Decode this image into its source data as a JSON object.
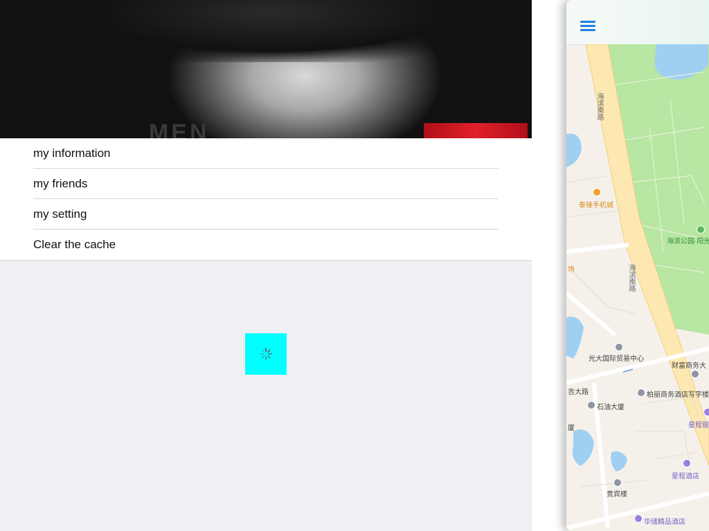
{
  "menu": {
    "items": [
      {
        "label": "my information"
      },
      {
        "label": "my friends"
      },
      {
        "label": "my setting"
      },
      {
        "label": "Clear the cache"
      }
    ]
  },
  "header": {
    "brand_text": "MEN",
    "image_desc_icon": "profile-photo"
  },
  "loading": {
    "icon": "activity-spinner-icon",
    "box_color": "#00ffff"
  },
  "map": {
    "labels": {
      "road_1": "海滨南路",
      "road_2": "海滨南路",
      "poi_phone_mall": "泰锋手机城",
      "poi_park": "海滨公园·阳光",
      "poi_trade_center": "光大国际贸易中心",
      "poi_finance": "财富商务大",
      "poi_road_ji": "吉大路",
      "poi_hotel_office": "柏丽商务酒店写字楼",
      "poi_oil_building": "石油大厦",
      "poi_star_hotel": "星程酒店",
      "poi_star_2": "星程银",
      "poi_guest_house": "贵宾楼",
      "poi_huachu_hotel": "华储精品酒店",
      "poi_sha": "厦",
      "poi_chang": "场"
    }
  }
}
